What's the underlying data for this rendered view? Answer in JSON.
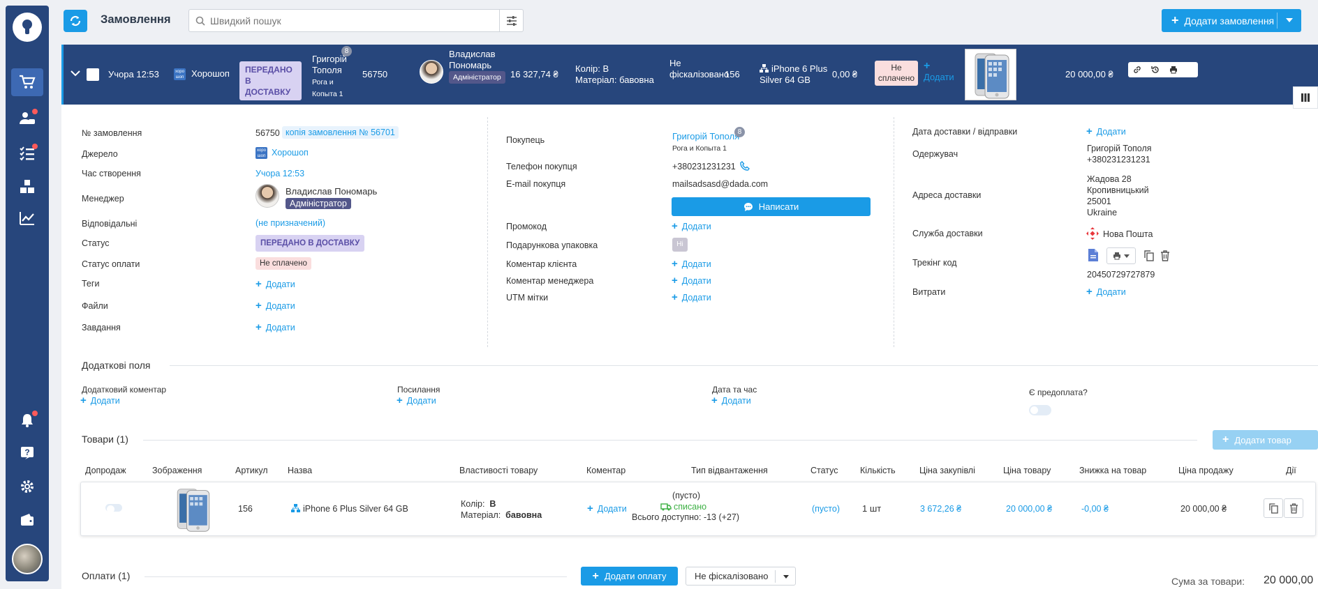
{
  "app": {
    "page_title": "Замовлення",
    "search_placeholder": "Швидкий пошук",
    "add_order_label": "Додати замовлення"
  },
  "order_bar": {
    "time": "Учора 12:53",
    "source": "Хорошоп",
    "source_icon_text": "хоро шоп",
    "status": "ПЕРЕДАНО В ДОСТАВКУ",
    "customer_name": "Григорій Тополя",
    "customer_badge": "8",
    "customer_company": "Рога и Копыта 1",
    "order_number": "56750",
    "manager_name": "Владислав Пономарь",
    "manager_role": "Адміністратор",
    "total": "16 327,74 ₴",
    "prop_color_label": "Колір:",
    "prop_color_value": "В",
    "prop_material_label": "Матеріал:",
    "prop_material_value": "бавовна",
    "fiscal": "Не фіскалізовано",
    "sku": "156",
    "product": "iPhone 6 Plus Silver 64 GB",
    "paid_amount": "0,00 ₴",
    "payment_status": "Не сплачено",
    "add_label": "Додати",
    "sum": "20 000,00 ₴"
  },
  "details": {
    "col1": {
      "order_number_label": "№ замовлення",
      "order_number_value": "56750",
      "order_copy_chip": "копія замовлення № 56701",
      "source_label": "Джерело",
      "source_value": "Хорошоп",
      "created_label": "Час створення",
      "created_value": "Учора 12:53",
      "manager_label": "Менеджер",
      "manager_name": "Владислав Пономарь",
      "manager_role": "Адміністратор",
      "responsible_label": "Відповідальні",
      "responsible_value": "(не призначений)",
      "status_label": "Статус",
      "status_value": "ПЕРЕДАНО В ДОСТАВКУ",
      "payment_status_label": "Статус оплати",
      "payment_status_value": "Не сплачено",
      "tags_label": "Теги",
      "files_label": "Файли",
      "tasks_label": "Завдання",
      "add_label": "Додати"
    },
    "col2": {
      "buyer_label": "Покупець",
      "buyer_name": "Григорій Тополя",
      "buyer_badge": "8",
      "buyer_company": "Рога и Копыта 1",
      "phone_label": "Телефон покупця",
      "phone_value": "+380231231231",
      "email_label": "E-mail покупця",
      "email_value": "mailsadsasd@dada.com",
      "write_label": "Написати",
      "promo_label": "Промокод",
      "gift_label": "Подарункова упаковка",
      "gift_value": "Ні",
      "client_comment_label": "Коментар клієнта",
      "manager_comment_label": "Коментар менеджера",
      "utm_label": "UTM мітки",
      "add_label": "Додати"
    },
    "col3": {
      "delivery_date_label": "Дата доставки / відправки",
      "recipient_label": "Одержувач",
      "recipient_name": "Григорій Тополя",
      "recipient_phone": "+380231231231",
      "address_label": "Адреса доставки",
      "address_line1": "Жадова 28",
      "address_line2": "Кропивницький",
      "address_line3": "25001",
      "address_line4": "Ukraine",
      "service_label": "Служба доставки",
      "service_value": "Нова Пошта",
      "tracking_label": "Трекінг код",
      "tracking_value": "20450729727879",
      "expenses_label": "Витрати",
      "add_label": "Додати"
    }
  },
  "extra_fields": {
    "title": "Додаткові поля",
    "comment_label": "Додатковий коментар",
    "link_label": "Посилання",
    "datetime_label": "Дата та час",
    "prepay_label": "Є предоплата?",
    "add_label": "Додати"
  },
  "products": {
    "title": "Товари (1)",
    "add_button": "Додати товар",
    "columns": [
      "Допродаж",
      "Зображення",
      "Артикул",
      "Назва",
      "Властивості товару",
      "Коментар",
      "Тип відвантаження",
      "Статус",
      "Кількість",
      "Ціна закупівлі",
      "Ціна товару",
      "Знижка на товар",
      "Ціна продажу",
      "Дії"
    ],
    "row": {
      "sku": "156",
      "name": "iPhone 6 Plus Silver 64 GB",
      "color_label": "Колір:",
      "color_value": "В",
      "material_label": "Матеріал:",
      "material_value": "бавовна",
      "comment_add": "Додати",
      "shipment_empty": "(пусто)",
      "shipment_status": "списано",
      "shipment_available": "Всього доступно: -13 (+27)",
      "status": "(пусто)",
      "quantity": "1 шт",
      "purchase_price": "3 672,26 ₴",
      "price": "20 000,00 ₴",
      "discount": "-0,00 ₴",
      "sale_price": "20 000,00 ₴"
    }
  },
  "payments": {
    "title": "Оплати (1)",
    "add_button": "Додати оплату",
    "fiscal_select": "Не фіскалізовано",
    "sum_label": "Сума за товари:",
    "sum_value": "20 000,00"
  },
  "colors": {
    "accent": "#1a9be6",
    "sidebar": "#27467c",
    "status_bg": "#d8d2f2",
    "unpaid_bg": "#fadede",
    "green": "#3cb043"
  }
}
